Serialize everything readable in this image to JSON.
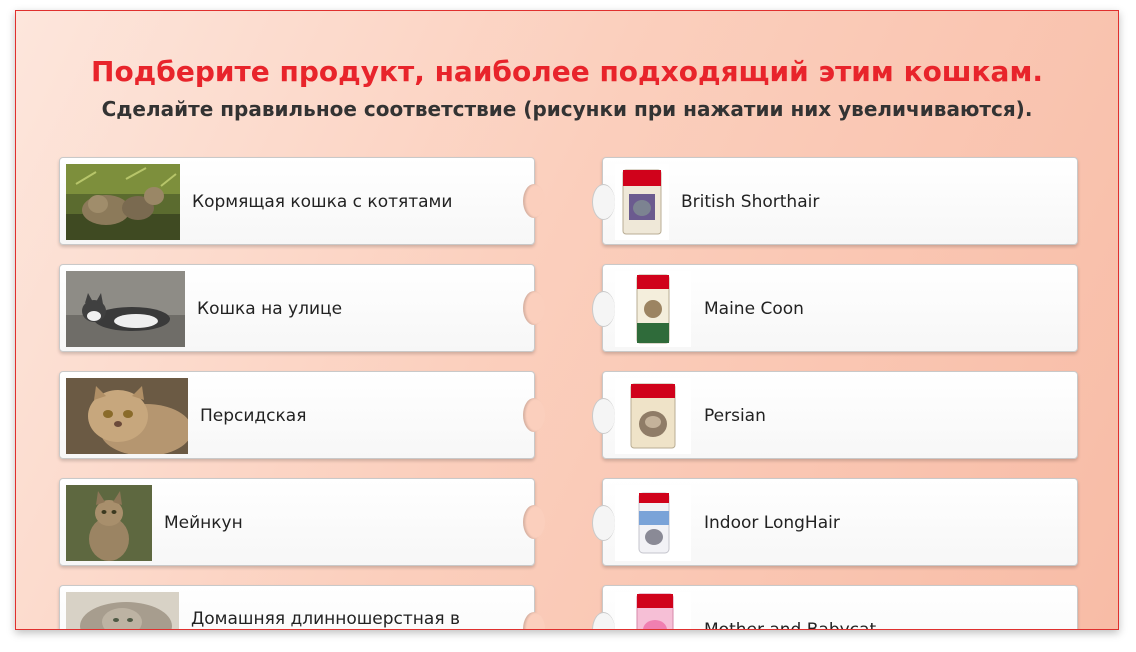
{
  "header": {
    "title": "Подберите продукт, наиболее подходящий этим кошкам.",
    "subtitle": "Сделайте правильное соответствие (рисунки при нажатии них увеличиваются)."
  },
  "cats": [
    {
      "label": "Кормящая кошка с котятами",
      "icon": "cat-with-kittens-photo"
    },
    {
      "label": "Кошка на улице",
      "icon": "outdoor-cat-photo"
    },
    {
      "label": "Персидская",
      "icon": "persian-cat-photo"
    },
    {
      "label": "Мейнкун",
      "icon": "maine-coon-photo"
    },
    {
      "label": "Домашняя длинношерстная в",
      "icon": "longhair-cat-photo"
    }
  ],
  "products": [
    {
      "label": "British Shorthair",
      "icon": "royal-canin-package"
    },
    {
      "label": "Maine Coon",
      "icon": "royal-canin-package"
    },
    {
      "label": "Persian",
      "icon": "royal-canin-package"
    },
    {
      "label": "Indoor LongHair",
      "icon": "royal-canin-package"
    },
    {
      "label": "Mother and Babycat",
      "icon": "royal-canin-package"
    }
  ],
  "colors": {
    "title": "#e8242b",
    "brand_red": "#d0021b",
    "frame_border": "#e0302e"
  }
}
